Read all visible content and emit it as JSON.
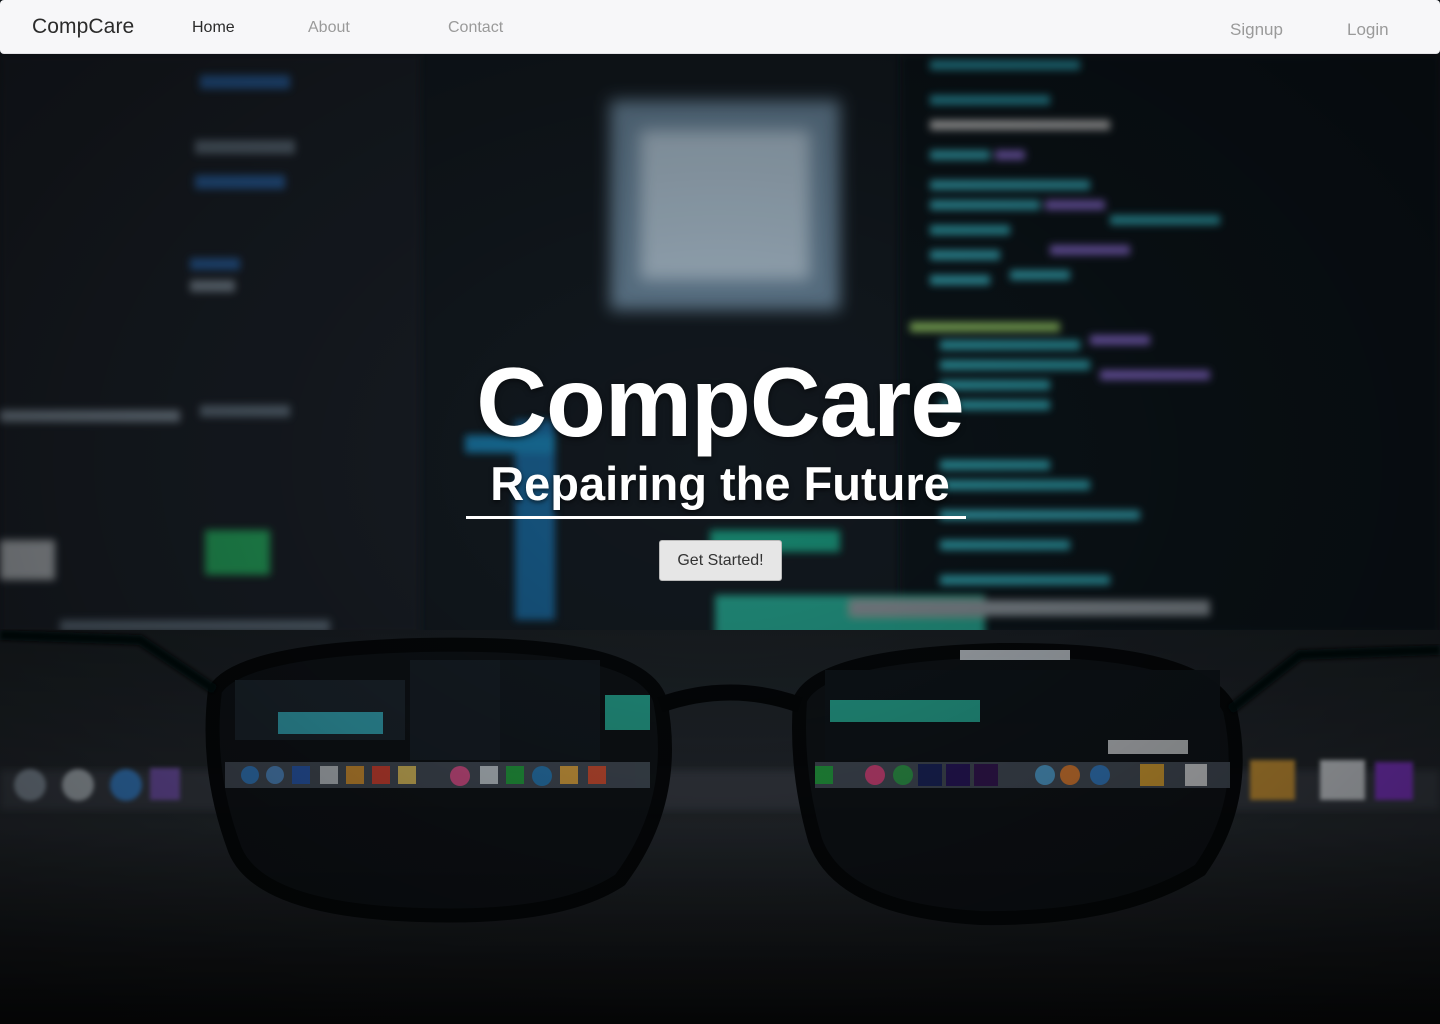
{
  "navbar": {
    "brand": "CompCare",
    "links": [
      {
        "label": "Home",
        "active": true
      },
      {
        "label": "About",
        "active": false
      },
      {
        "label": "Contact",
        "active": false
      }
    ],
    "right_links": [
      {
        "label": "Signup"
      },
      {
        "label": "Login"
      }
    ]
  },
  "hero": {
    "title": "CompCare",
    "subtitle": "Repairing the Future",
    "cta_label": "Get Started!"
  },
  "colors": {
    "navbar_bg": "#f7f7f9",
    "brand_text": "#2b2b2b",
    "inactive_link": "#9a9a9a",
    "hero_text": "#ffffff",
    "cta_bg": "#e6e6e6"
  }
}
